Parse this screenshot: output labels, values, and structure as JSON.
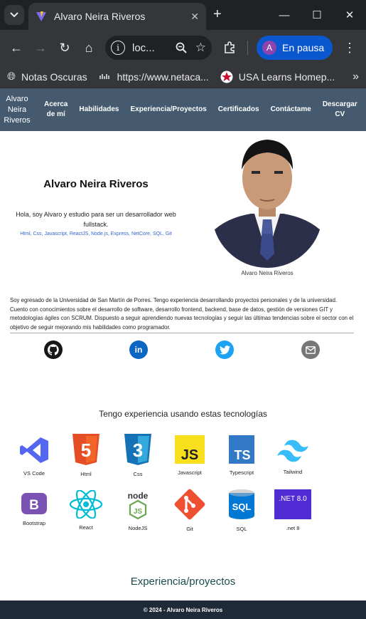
{
  "browser": {
    "tab_title": "Alvaro Neira Riveros",
    "url": "loc...",
    "profile_initial": "A",
    "profile_label": "En pausa",
    "bookmarks": [
      {
        "icon": "globe-icon",
        "label": "Notas Oscuras"
      },
      {
        "icon": "cisco-icon",
        "label": "https://www.netaca..."
      },
      {
        "icon": "star-icon",
        "label": "USA Learns Homep..."
      }
    ]
  },
  "nav": {
    "brand": [
      "Alvaro",
      "Neira",
      "Riveros"
    ],
    "items": [
      {
        "label": [
          "Acerca",
          "de mí"
        ]
      },
      {
        "label": [
          "Habilidades"
        ]
      },
      {
        "label": [
          "Experiencia/Proyectos"
        ]
      },
      {
        "label": [
          "Certificados"
        ]
      },
      {
        "label": [
          "Contáctame"
        ]
      },
      {
        "label": [
          "Descargar",
          "CV"
        ]
      }
    ]
  },
  "hero": {
    "name": "Alvaro Neira Riveros",
    "intro": "Hola, soy Alvaro y estudio para ser un desarrollador web fullstack.",
    "techs": "Html, Css, Javascript, ReactJS, Node.js, Express, NetCore, SQL, Git",
    "photo_caption": "Alvaro Neira Riveros"
  },
  "about": "Soy egresado de la Universidad de San Martín de Porres. Tengo experiencia desarrollando proyectos personales y de la universidad. Cuento con conocimientos sobre el desarrollo de software, desarrollo frontend, backend, base de datos, gestión de versiones GIT y metodologías ágiles con SCRUM. Dispuesto a seguir aprendiendo nuevas tecnologías y seguir las últimas tendencias sobre el sector con el objetivo de seguir mejorando mis habilidades como programador.",
  "social": [
    {
      "name": "github-icon",
      "color": "#181717"
    },
    {
      "name": "linkedin-icon",
      "color": "#0a66c2"
    },
    {
      "name": "twitter-icon",
      "color": "#1da1f2"
    },
    {
      "name": "mail-icon",
      "color": "#777777"
    }
  ],
  "tech_title": "Tengo experiencia usando estas tecnologías",
  "techs": [
    {
      "label": "VS Code",
      "icon": "vscode-icon"
    },
    {
      "label": "Html",
      "icon": "html5-icon"
    },
    {
      "label": "Css",
      "icon": "css3-icon"
    },
    {
      "label": "Javascript",
      "icon": "javascript-icon"
    },
    {
      "label": "Typescript",
      "icon": "typescript-icon"
    },
    {
      "label": "Tailwind",
      "icon": "tailwind-icon"
    },
    {
      "label": "Bootstrap",
      "icon": "bootstrap-icon"
    },
    {
      "label": "React",
      "icon": "react-icon"
    },
    {
      "label": "NodeJS",
      "icon": "nodejs-icon"
    },
    {
      "label": "Git",
      "icon": "git-icon"
    },
    {
      "label": "SQL",
      "icon": "sql-icon"
    },
    {
      "label": ".net 8",
      "icon": "dotnet-icon"
    }
  ],
  "tech_badges": {
    "html": "5",
    "css": "3",
    "js": "JS",
    "ts": "TS",
    "bootstrap": "B",
    "node_top": "node",
    "node_bottom": "JS",
    "sql": "SQL",
    "dotnet": ".NET 8.0"
  },
  "experience_title": "Experiencia/proyectos",
  "footer": "© 2024 - Alvaro Neira Riveros"
}
